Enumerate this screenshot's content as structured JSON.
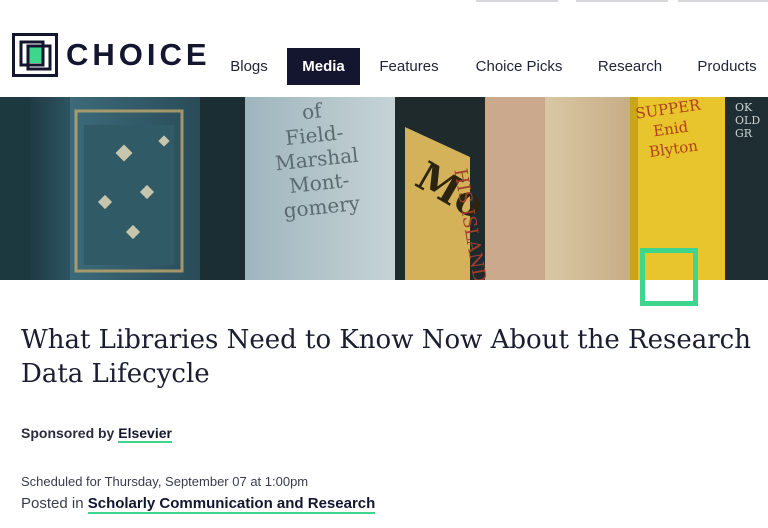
{
  "brand": {
    "name": "CHOICE",
    "accent": "#3dd68c",
    "navy": "#14162f"
  },
  "nav": {
    "items": [
      {
        "label": "Blogs",
        "active": false
      },
      {
        "label": "Media",
        "active": true
      },
      {
        "label": "Features",
        "active": false
      },
      {
        "label": "Choice Picks",
        "active": false
      },
      {
        "label": "Research",
        "active": false
      },
      {
        "label": "Products",
        "active": false
      }
    ]
  },
  "hero": {
    "book_texts": {
      "field_marshal": "of\nField-\nMarshal\nMont-\ngomery",
      "island": "HIS ISLAND",
      "enid": "SUPPER\nEnid\nBlyton",
      "far_right": "OK\nOLD\nGR",
      "mo": "Mo"
    }
  },
  "article": {
    "title": "What Libraries Need to Know Now About the Research Data Lifecycle",
    "sponsored_prefix": "Sponsored by",
    "sponsor": "Elsevier",
    "scheduled": "Scheduled for Thursday, September 07 at 1:00pm",
    "posted_prefix": "Posted in",
    "category": "Scholarly Communication and Research"
  }
}
